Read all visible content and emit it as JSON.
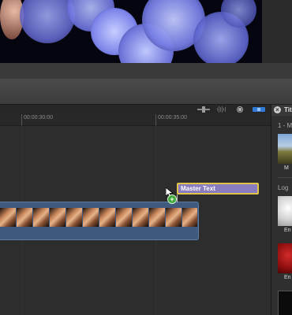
{
  "timeline": {
    "ruler": {
      "timecode_1": "00:00:30:00",
      "timecode_2": "00:00:35:00"
    },
    "title_clip": {
      "label": "Master Text",
      "fill": "#8a7cc0",
      "border": "#e0c44a"
    },
    "video_clip": {
      "color": "#3f5a7e"
    },
    "toolbar_icons": [
      "audio-skimming-icon",
      "waveform-icon",
      "solo-icon",
      "snapping-icon"
    ],
    "add_badge": "+"
  },
  "browser": {
    "close": "×",
    "title": "Titl",
    "category_1": "1 - M",
    "item_1_label": "M",
    "category_2": "Log",
    "item_2_label": "En",
    "item_3_label": "En"
  },
  "colors": {
    "accent_blue": "#2f7bd6",
    "add_green": "#3fa83a"
  }
}
